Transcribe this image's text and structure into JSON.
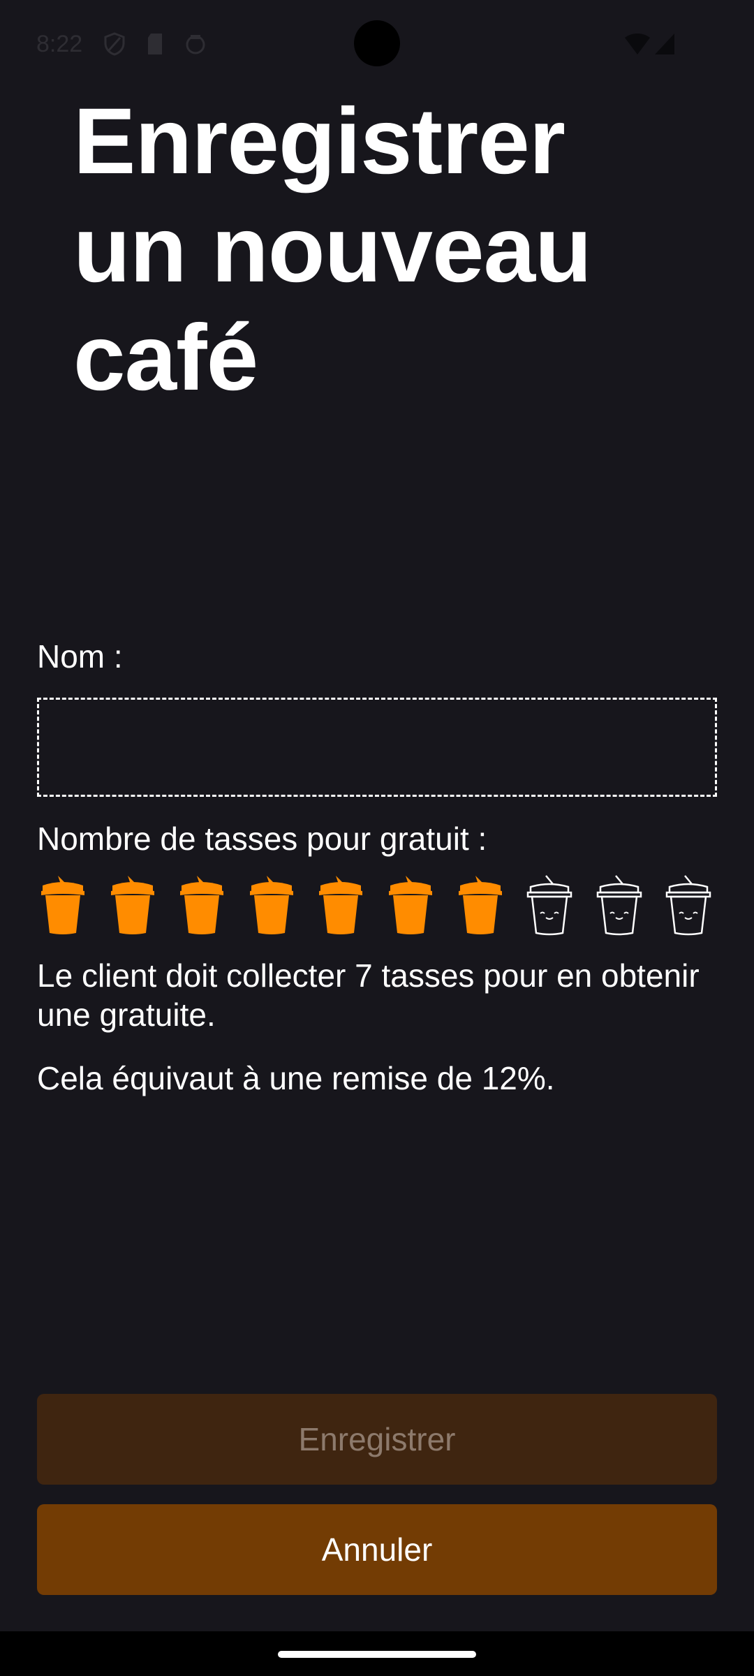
{
  "status_bar": {
    "time": "8:22",
    "icons": [
      "shield-icon",
      "sim-card-icon",
      "vpn-icon",
      "wifi-icon",
      "cell-signal-icon"
    ]
  },
  "title": "Enregistrer un nouveau café",
  "form": {
    "name_label": "Nom :",
    "name_value": "",
    "cups_label": "Nombre de tasses pour gratuit :",
    "cups_total": 10,
    "cups_selected": 7,
    "cup_filled_color": "#ff8c00",
    "cup_empty_color": "#ffffff",
    "info_collect": "Le client doit collecter 7 tasses pour en obtenir une gratuite.",
    "info_discount": "Cela équivaut à une remise de 12%."
  },
  "buttons": {
    "save_label": "Enregistrer",
    "cancel_label": "Annuler"
  },
  "colors": {
    "background": "#17161c",
    "accent": "#ff8c00",
    "save_disabled_bg": "#3f2510",
    "cancel_bg": "#733c04"
  }
}
